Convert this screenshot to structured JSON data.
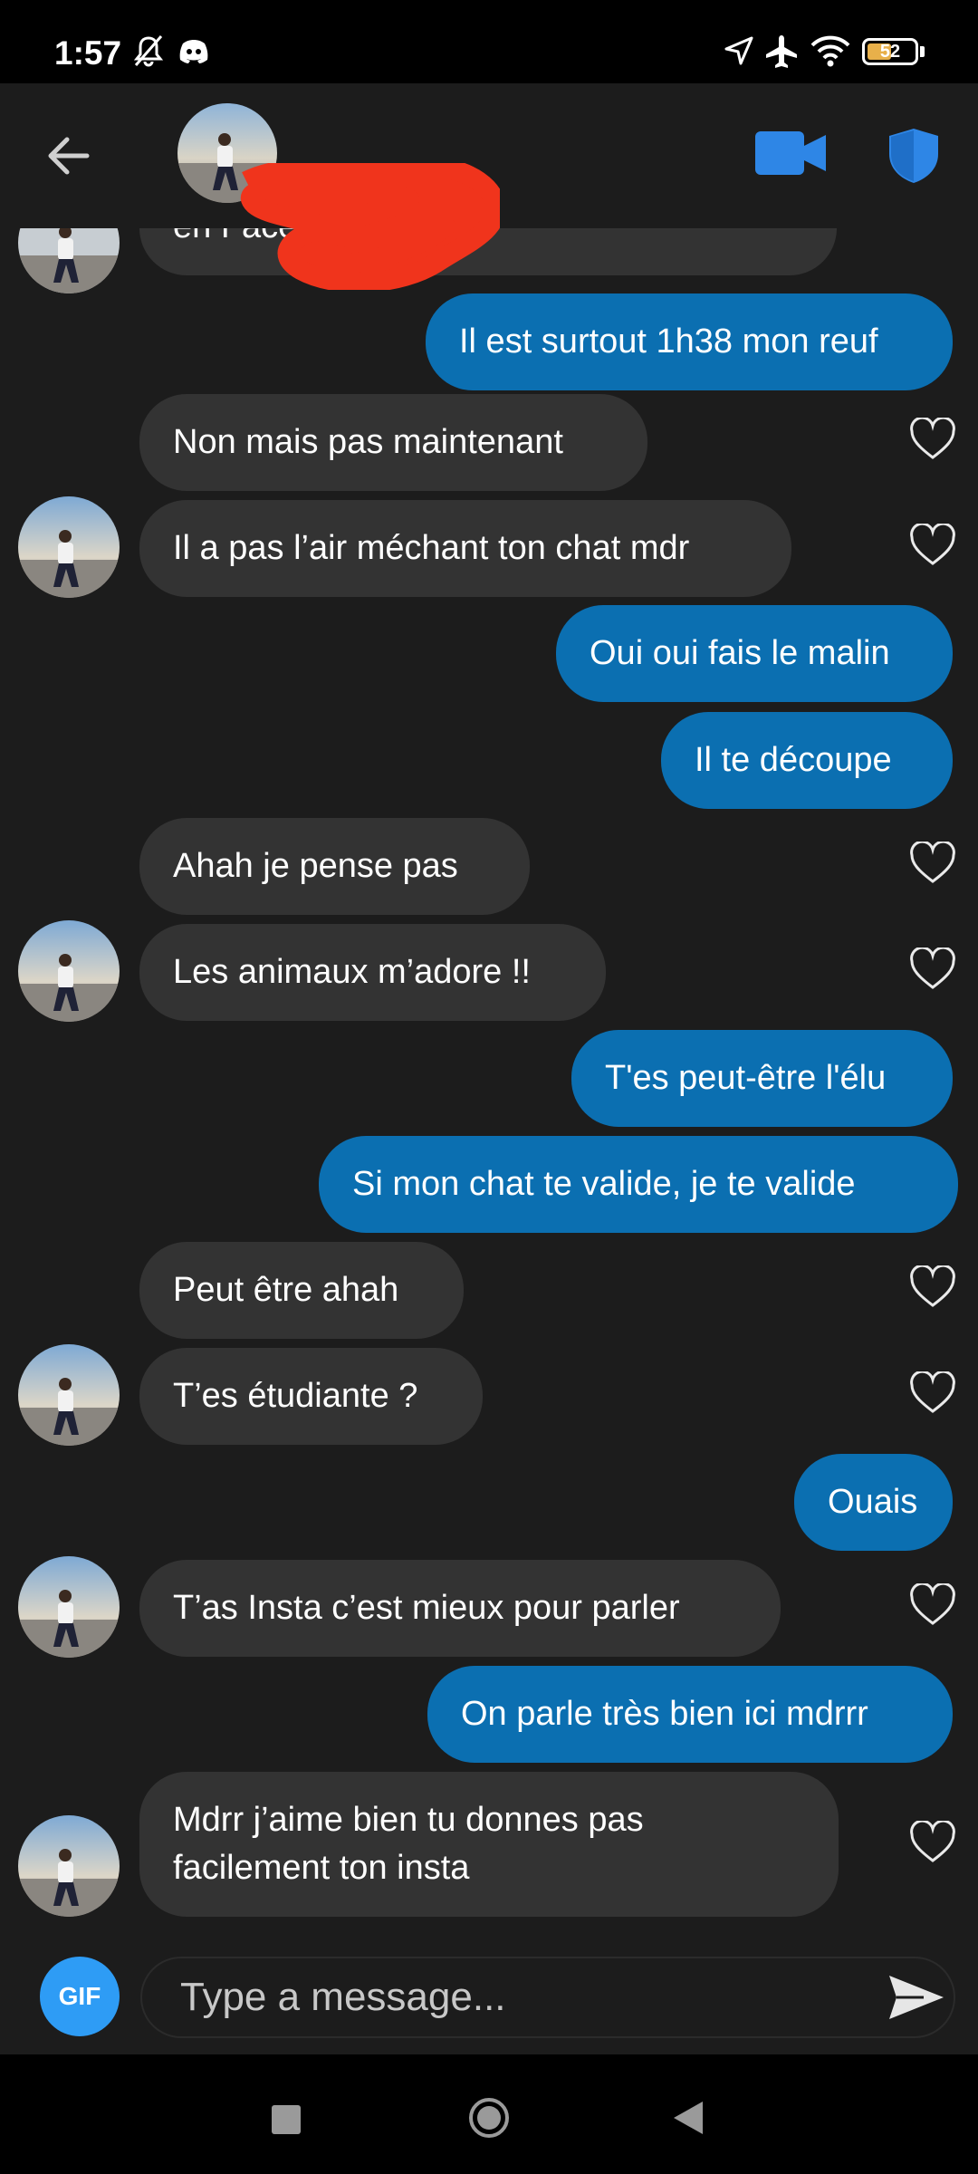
{
  "status_bar": {
    "time": "1:57",
    "battery": "52"
  },
  "composer": {
    "gif_label": "GIF",
    "placeholder": "Type a message..."
  },
  "messages": [
    {
      "text": "en FaceTime ?"
    },
    {
      "text": "Il est surtout 1h38 mon reuf"
    },
    {
      "text": "Non mais pas maintenant"
    },
    {
      "text": "Il a pas l’air méchant ton chat mdr"
    },
    {
      "text": "Oui oui fais le malin"
    },
    {
      "text": "Il te découpe"
    },
    {
      "text": "Ahah je pense pas"
    },
    {
      "text": "Les animaux m’adore !!"
    },
    {
      "text": "T'es peut-être l'élu"
    },
    {
      "text": "Si mon chat te valide, je te valide"
    },
    {
      "text": "Peut être ahah"
    },
    {
      "text": "T’es étudiante ?"
    },
    {
      "text": "Ouais"
    },
    {
      "text": "T’as Insta c’est mieux pour parler"
    },
    {
      "text": "On parle très bien ici mdrrr"
    },
    {
      "text": "Mdrr j’aime bien tu donnes pas"
    },
    {
      "text": "facilement ton insta"
    }
  ],
  "colors": {
    "background": "#1c1c1c",
    "incoming_bubble": "#333333",
    "outgoing_bubble": "#0b6fb1",
    "accent": "#2e9cf5",
    "redaction": "#f0341c"
  }
}
